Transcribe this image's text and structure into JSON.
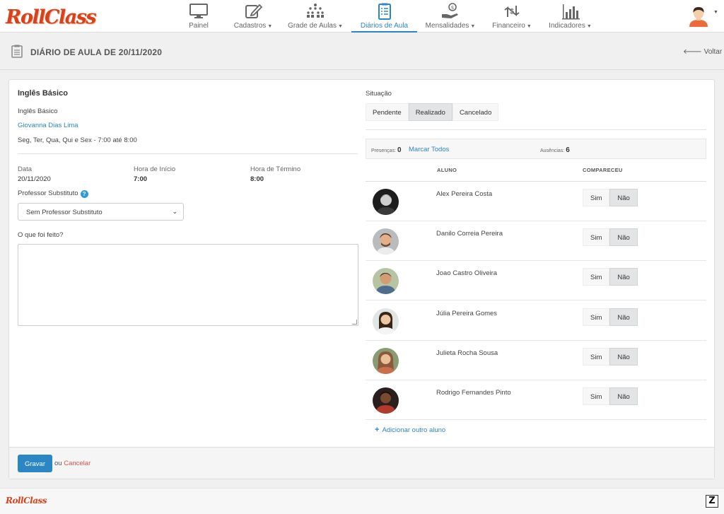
{
  "brand": {
    "logo_text": "RollClass",
    "accent": "#d8421a",
    "link_color": "#2b86c5"
  },
  "nav": {
    "items": [
      {
        "label": "Painel",
        "icon": "monitor-icon",
        "dropdown": false
      },
      {
        "label": "Cadastros",
        "icon": "edit-icon",
        "dropdown": true
      },
      {
        "label": "Grade de Aulas",
        "icon": "classroom-grid-icon",
        "dropdown": true
      },
      {
        "label": "Diários de Aula",
        "icon": "clipboard-icon",
        "dropdown": false,
        "active": true
      },
      {
        "label": "Mensalidades",
        "icon": "money-hand-icon",
        "dropdown": true
      },
      {
        "label": "Financeiro",
        "icon": "cash-flow-icon",
        "dropdown": true
      },
      {
        "label": "Indicadores",
        "icon": "bar-chart-icon",
        "dropdown": true
      }
    ]
  },
  "header": {
    "title": "DIÁRIO DE AULA DE 20/11/2020",
    "back_label": "Voltar"
  },
  "lesson": {
    "course_title": "Inglês Básico",
    "course_subtitle": "Inglês Básico",
    "teacher": "Giovanna Dias Lima",
    "schedule": "Seg, Ter, Qua, Qui e Sex - 7:00 até 8:00",
    "date_label": "Data",
    "date_value": "20/11/2020",
    "start_label": "Hora de Início",
    "start_value": "7:00",
    "end_label": "Hora de Término",
    "end_value": "8:00",
    "substitute_label": "Professor Substituto",
    "substitute_help": "?",
    "substitute_value": "Sem Professor Substituto",
    "done_label": "O que foi feito?",
    "done_value": ""
  },
  "situation": {
    "label": "Situação",
    "options": [
      "Pendente",
      "Realizado",
      "Cancelado"
    ],
    "selected": "Realizado"
  },
  "stats": {
    "presences_label": "Presenças:",
    "presences_value": "0",
    "mark_all_label": "Marcar Todos",
    "absences_label": "Ausências:",
    "absences_value": "6"
  },
  "table": {
    "col_student": "ALUNO",
    "col_attended": "COMPARECEU",
    "yes_label": "Sim",
    "no_label": "Não",
    "students": [
      {
        "name": "Alex Pereira Costa",
        "attended": "Não"
      },
      {
        "name": "Danilo Correia Pereira",
        "attended": "Não"
      },
      {
        "name": "Joao Castro Oliveira",
        "attended": "Não"
      },
      {
        "name": "Júlia Pereira Gomes",
        "attended": "Não"
      },
      {
        "name": "Julieta Rocha Sousa",
        "attended": "Não"
      },
      {
        "name": "Rodrigo Fernandes Pinto",
        "attended": "Não"
      }
    ],
    "add_label": "Adicionar outro aluno"
  },
  "footer": {
    "save_label": "Gravar",
    "or_label": "ou",
    "cancel_label": "Cancelar"
  },
  "bottom": {
    "logo_text": "RollClass",
    "badge": "Z"
  }
}
